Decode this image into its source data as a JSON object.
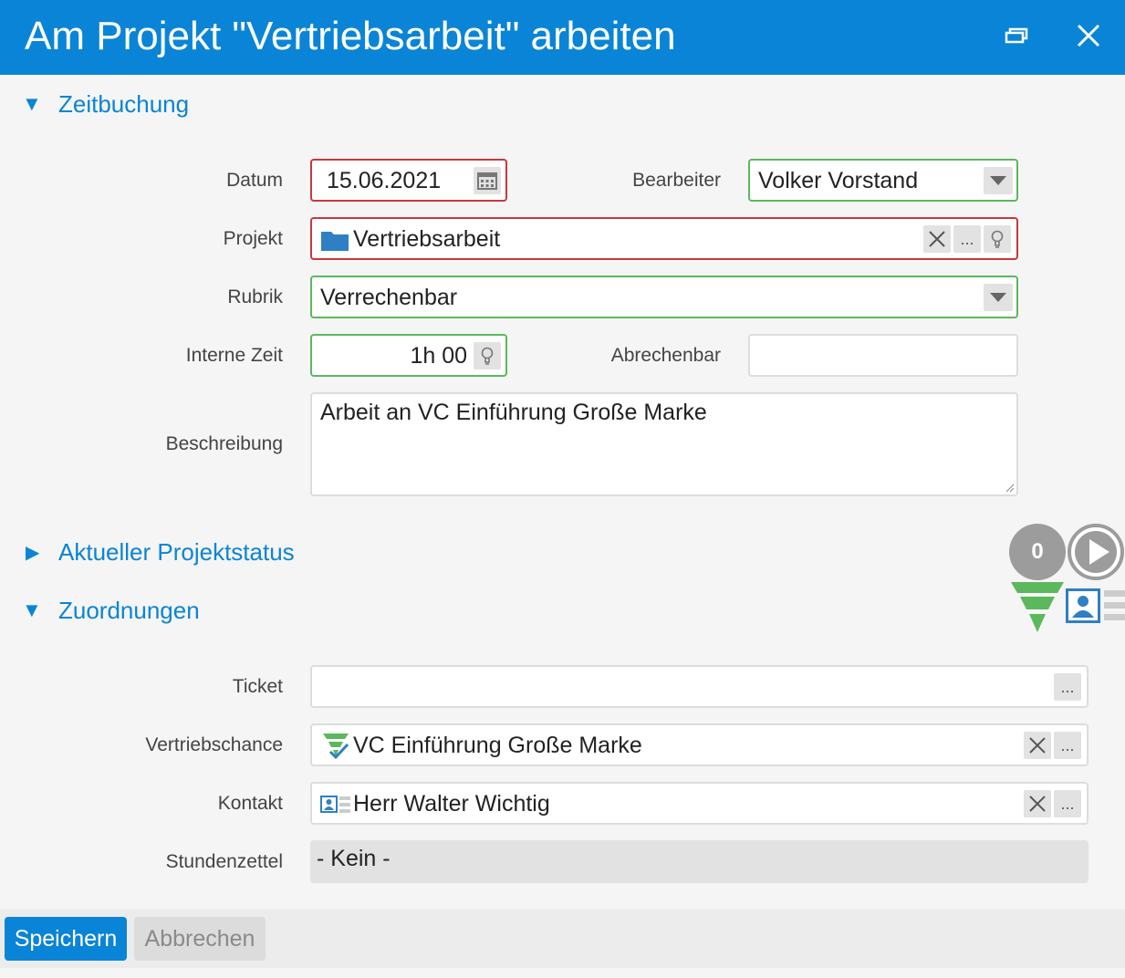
{
  "window": {
    "title": "Am Projekt \"Vertriebsarbeit\" arbeiten"
  },
  "sections": {
    "zeitbuchung": "Zeitbuchung",
    "projektstatus": "Aktueller Projektstatus",
    "zuordnungen": "Zuordnungen"
  },
  "form": {
    "datum_label": "Datum",
    "datum_value": "15.06.2021",
    "bearbeiter_label": "Bearbeiter",
    "bearbeiter_value": "Volker Vorstand",
    "projekt_label": "Projekt",
    "projekt_value": "Vertriebsarbeit",
    "rubrik_label": "Rubrik",
    "rubrik_value": "Verrechenbar",
    "interne_zeit_label": "Interne Zeit",
    "interne_zeit_value": "1h 00",
    "abrechenbar_label": "Abrechenbar",
    "abrechenbar_value": "",
    "beschreibung_label": "Beschreibung",
    "beschreibung_value": "Arbeit an VC Einführung Große Marke"
  },
  "assignments": {
    "ticket_label": "Ticket",
    "ticket_value": "",
    "vertriebschance_label": "Vertriebschance",
    "vertriebschance_value": "VC Einführung Große Marke",
    "kontakt_label": "Kontakt",
    "kontakt_value": "Herr Walter Wichtig",
    "stundenzettel_label": "Stundenzettel",
    "stundenzettel_value": "- Kein -"
  },
  "side": {
    "counter": "0"
  },
  "buttons": {
    "save": "Speichern",
    "cancel": "Abbrechen",
    "more": "..."
  },
  "colors": {
    "accent": "#0a84d6",
    "error_border": "#c8383e",
    "valid_border": "#5cb85c",
    "funnel": "#5cb85c",
    "contact": "#2f7fc4"
  },
  "icons": [
    "restore-icon",
    "close-icon",
    "calendar-icon",
    "folder-icon",
    "clear-icon",
    "lightbulb-icon",
    "dropdown-arrow-icon",
    "funnel-icon",
    "contact-card-icon",
    "play-icon"
  ]
}
